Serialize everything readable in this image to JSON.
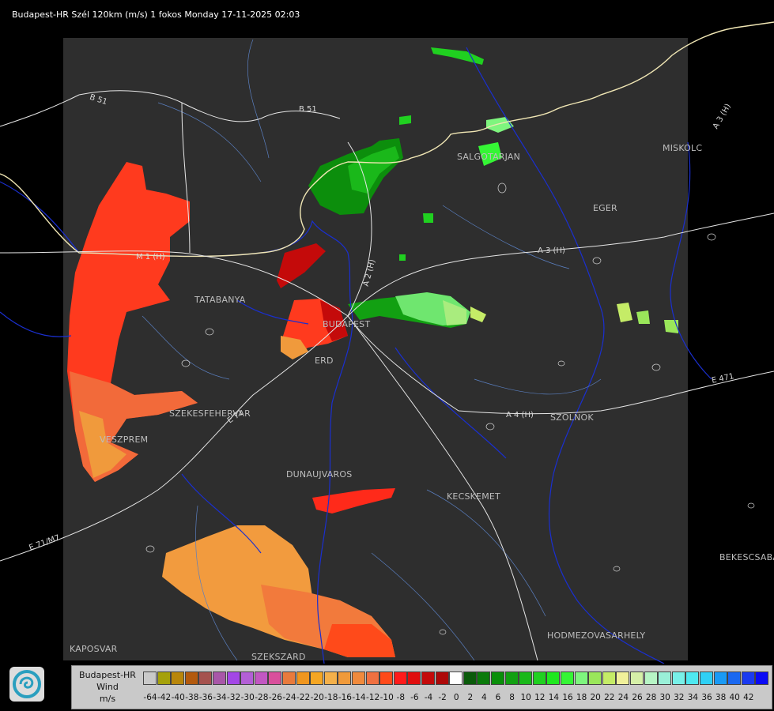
{
  "header": {
    "title": "Budapest-HR Szél 120km (m/s) 1 fokos Monday 17-11-2025 02:03"
  },
  "map": {
    "places": [
      {
        "name": "SALGOTARJAN"
      },
      {
        "name": "MISKOLC"
      },
      {
        "name": "EGER"
      },
      {
        "name": "TATABANYA"
      },
      {
        "name": "BUDAPEST"
      },
      {
        "name": "ERD"
      },
      {
        "name": "SZEKESFEHERVAR"
      },
      {
        "name": "VESZPREM"
      },
      {
        "name": "DUNAUJVAROS"
      },
      {
        "name": "KECSKEMET"
      },
      {
        "name": "SZOLNOK"
      },
      {
        "name": "HODMEZOVASARHELY"
      },
      {
        "name": "BEKESCSABA"
      },
      {
        "name": "KAPOSVAR"
      },
      {
        "name": "SZEKSZARD"
      }
    ],
    "roads": [
      {
        "name": "B 51"
      },
      {
        "name": "B 51"
      },
      {
        "name": "A 3 (H)"
      },
      {
        "name": "A 3 (H)"
      },
      {
        "name": "A 2 (H)"
      },
      {
        "name": "A 4 (H)"
      },
      {
        "name": "E 471"
      },
      {
        "name": "E 71"
      },
      {
        "name": "E 71/M7"
      },
      {
        "name": "M 1 (H)"
      }
    ]
  },
  "legend": {
    "title_lines": [
      "Budapest-HR",
      "Wind",
      "m/s"
    ],
    "colors": [
      "#c9c9c9",
      "#a5a10a",
      "#b8860b",
      "#b35a0e",
      "#a5524e",
      "#a857a8",
      "#a347e6",
      "#b35fd6",
      "#c257c2",
      "#d94f9c",
      "#e87a3c",
      "#f0961e",
      "#f5a623",
      "#f4b04a",
      "#f09a3a",
      "#f08a3c",
      "#f07040",
      "#ff4a1a",
      "#ff1a1a",
      "#e00e0e",
      "#c40a0a",
      "#ad0808",
      "#ffffff",
      "#0a5a0a",
      "#0a7a0a",
      "#0a8f0a",
      "#12a012",
      "#1ab81a",
      "#20d020",
      "#1fe81f",
      "#35f535",
      "#7ef57e",
      "#9ae65a",
      "#c5ec67",
      "#f0f09a",
      "#d6f0a8",
      "#b7f5c5",
      "#9af0d8",
      "#78f0e8",
      "#4fe8f0",
      "#2fd0f5",
      "#1a9af5",
      "#1a68f0",
      "#1a3af0",
      "#0a0af5"
    ],
    "ticks": [
      "-64",
      "-42",
      "-40",
      "-38",
      "-36",
      "-34",
      "-32",
      "-30",
      "-28",
      "-26",
      "-24",
      "-22",
      "-20",
      "-18",
      "-16",
      "-14",
      "-12",
      "-10",
      "-8",
      "-6",
      "-4",
      "-2",
      "0",
      "2",
      "4",
      "6",
      "8",
      "10",
      "12",
      "14",
      "16",
      "18",
      "20",
      "22",
      "24",
      "26",
      "28",
      "30",
      "32",
      "34",
      "36",
      "38",
      "40",
      "42"
    ]
  }
}
